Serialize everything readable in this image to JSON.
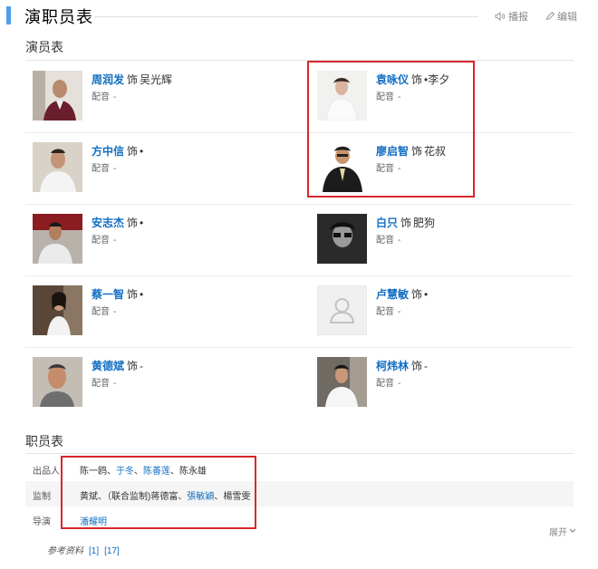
{
  "header": {
    "title": "演职员表",
    "report_label": "播报",
    "edit_label": "编辑"
  },
  "cast_section": {
    "title": "演员表",
    "dub_label": "配音",
    "role_prefix": "饰",
    "items": [
      {
        "actor": "周润发",
        "role": "吴光辉",
        "dub": "-"
      },
      {
        "actor": "袁咏仪",
        "role": "•李夕",
        "dub": "-"
      },
      {
        "actor": "方中信",
        "role": "•",
        "dub": "-"
      },
      {
        "actor": "廖启智",
        "role": "花叔",
        "dub": "-"
      },
      {
        "actor": "安志杰",
        "role": "•",
        "dub": "-"
      },
      {
        "actor": "白只",
        "role": "肥狗",
        "dub": "-"
      },
      {
        "actor": "蔡一智",
        "role": "•",
        "dub": "-"
      },
      {
        "actor": "卢慧敏",
        "role": "•",
        "dub": "-"
      },
      {
        "actor": "黄德斌",
        "role": "-",
        "dub": "-"
      },
      {
        "actor": "柯炜林",
        "role": "-",
        "dub": "-"
      }
    ]
  },
  "staff_section": {
    "title": "职员表",
    "rows": [
      {
        "label": "出品人",
        "names": [
          {
            "text": "陈一鸥",
            "link": false
          },
          {
            "text": "、",
            "link": false
          },
          {
            "text": "于冬",
            "link": true
          },
          {
            "text": "、",
            "link": false
          },
          {
            "text": "陈善莲",
            "link": true
          },
          {
            "text": "、",
            "link": false
          },
          {
            "text": "陈永雄",
            "link": false
          }
        ]
      },
      {
        "label": "监制",
        "names": [
          {
            "text": "黄斌",
            "link": false
          },
          {
            "text": "、",
            "link": false
          },
          {
            "text": "（联合监制)蒋德富",
            "link": false
          },
          {
            "text": "、",
            "link": false
          },
          {
            "text": "張敏穎",
            "link": true
          },
          {
            "text": "、",
            "link": false
          },
          {
            "text": "楊雪雯",
            "link": false
          }
        ]
      },
      {
        "label": "导演",
        "names": [
          {
            "text": "潘耀明",
            "link": true
          }
        ]
      }
    ],
    "expand_label": "展开"
  },
  "references": {
    "title": "参考资料",
    "refs": [
      "[1]",
      "[17]"
    ]
  },
  "colors": {
    "accent": "#4f9cee",
    "link": "#136ec2",
    "highlight_box": "#d9272e"
  }
}
